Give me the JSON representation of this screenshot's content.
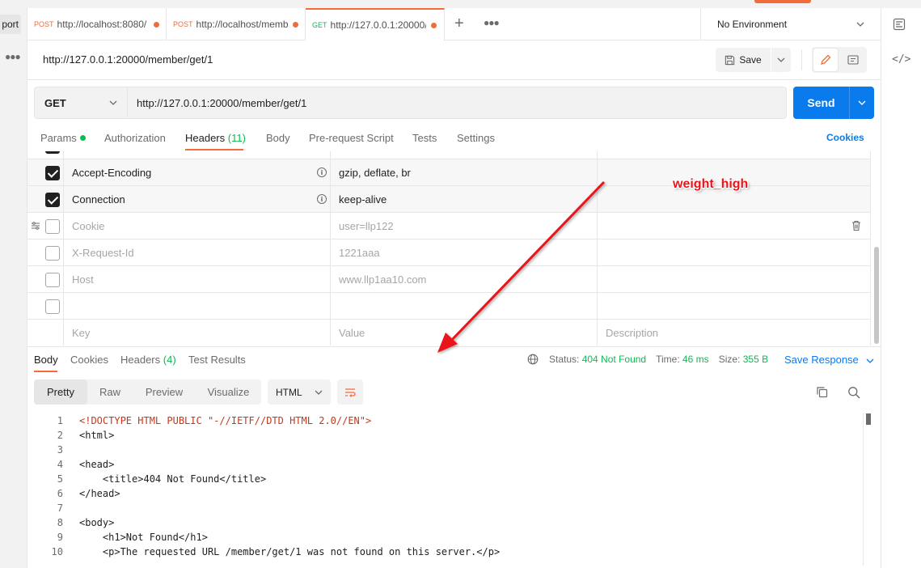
{
  "sidebar": {
    "import_label": "port",
    "more_icon": "more-horizontal-icon"
  },
  "tabs": [
    {
      "method": "POST",
      "url": "http://localhost:8080/",
      "unsaved": true
    },
    {
      "method": "POST",
      "url": "http://localhost/memb",
      "unsaved": true
    },
    {
      "method": "GET",
      "url": "http://127.0.0.1:20000/r",
      "unsaved": true,
      "active": true
    }
  ],
  "environment": {
    "label": "No Environment"
  },
  "request": {
    "title": "http://127.0.0.1:20000/member/get/1",
    "save_label": "Save",
    "method": "GET",
    "url": "http://127.0.0.1:20000/member/get/1",
    "send_label": "Send"
  },
  "request_tabs": {
    "params": "Params",
    "authorization": "Authorization",
    "headers": "Headers",
    "headers_count": "(11)",
    "body": "Body",
    "prerequest": "Pre-request Script",
    "tests": "Tests",
    "settings": "Settings",
    "cookies": "Cookies"
  },
  "headers_table": {
    "rows": [
      {
        "checked": true,
        "key": "Accept-Encoding",
        "value": "gzip, deflate, br",
        "description": "",
        "info": true
      },
      {
        "checked": true,
        "key": "Connection",
        "value": "keep-alive",
        "description": "",
        "info": true
      },
      {
        "checked": false,
        "key": "Cookie",
        "value": "user=llp122",
        "description": ""
      },
      {
        "checked": false,
        "key": "X-Request-Id",
        "value": "1221aaa",
        "description": ""
      },
      {
        "checked": false,
        "key": "Host",
        "value": "www.llp1aa10.com",
        "description": ""
      },
      {
        "checked": false,
        "key": "",
        "value": "",
        "description": ""
      }
    ],
    "placeholder_key": "Key",
    "placeholder_value": "Value",
    "placeholder_description": "Description"
  },
  "response": {
    "tabs": {
      "body": "Body",
      "cookies": "Cookies",
      "headers": "Headers",
      "headers_count": "(4)",
      "test_results": "Test Results"
    },
    "status_label": "Status:",
    "status_value": "404 Not Found",
    "time_label": "Time:",
    "time_value": "46 ms",
    "size_label": "Size:",
    "size_value": "355 B",
    "save_response": "Save Response",
    "views": [
      "Pretty",
      "Raw",
      "Preview",
      "Visualize"
    ],
    "language": "HTML",
    "code_lines": [
      "<!DOCTYPE HTML PUBLIC \"-//IETF//DTD HTML 2.0//EN\">",
      "<html>",
      "",
      "<head>",
      "    <title>404 Not Found</title>",
      "</head>",
      "",
      "<body>",
      "    <h1>Not Found</h1>",
      "    <p>The requested URL /member/get/1 was not found on this server.</p>"
    ]
  },
  "annotation": {
    "text": "weight_high",
    "color": "#e8141a"
  },
  "colors": {
    "accent": "#f26b3a",
    "primary": "#097bed",
    "success": "#0cbb52"
  }
}
